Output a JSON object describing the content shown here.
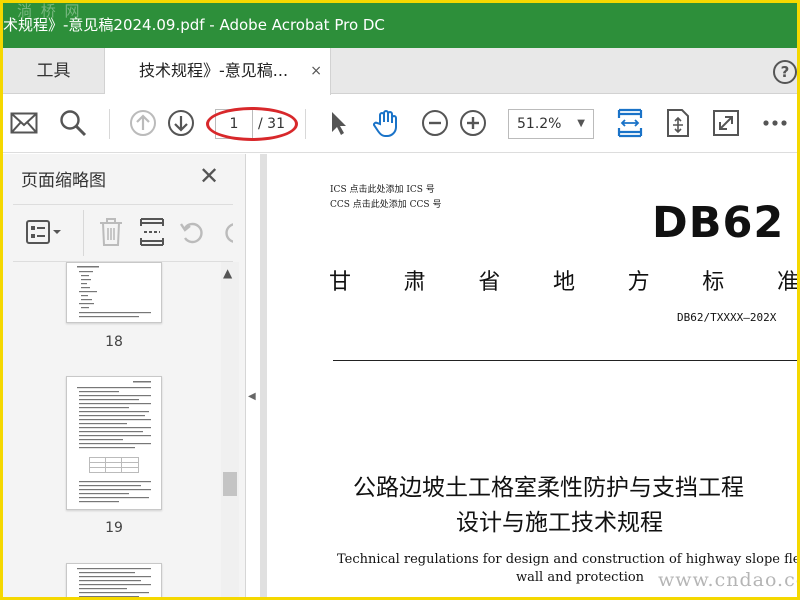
{
  "window": {
    "title": "术规程》-意见稿2024.09.pdf - Adobe Acrobat Pro DC",
    "watermark_top": "淌 桥 网"
  },
  "tabs": {
    "tools_label": "工具",
    "doc_label": "技术规程》-意见稿...",
    "close": "×",
    "help": "?"
  },
  "toolbar": {
    "page_current": "1",
    "page_total": "/ 31",
    "zoom": "51.2%"
  },
  "sidebar": {
    "title": "页面缩略图",
    "thumbnails": [
      {
        "label": "18"
      },
      {
        "label": "19"
      }
    ]
  },
  "document": {
    "ics": "ICS   点击此处添加 ICS 号",
    "ccs": "CCS   点击此处添加 CCS 号",
    "db": "DB62",
    "std_chars": [
      "甘",
      "肃",
      "省",
      "地",
      "方",
      "标",
      "准"
    ],
    "docnum": "DB62/TXXXX—202X",
    "title_line1": "公路边坡土工格室柔性防护与支挡工程",
    "title_line2": "设计与施工技术规程",
    "en_line1": "Technical regulations for design and construction of highway slope flexible retaining",
    "en_line2": "wall and protection"
  },
  "watermark_bottom": "www.cndao.com",
  "colors": {
    "titlebar": "#2d8f3a",
    "border": "#f5d800",
    "highlight": "#d8282b",
    "icon_blue": "#1a73c8"
  }
}
